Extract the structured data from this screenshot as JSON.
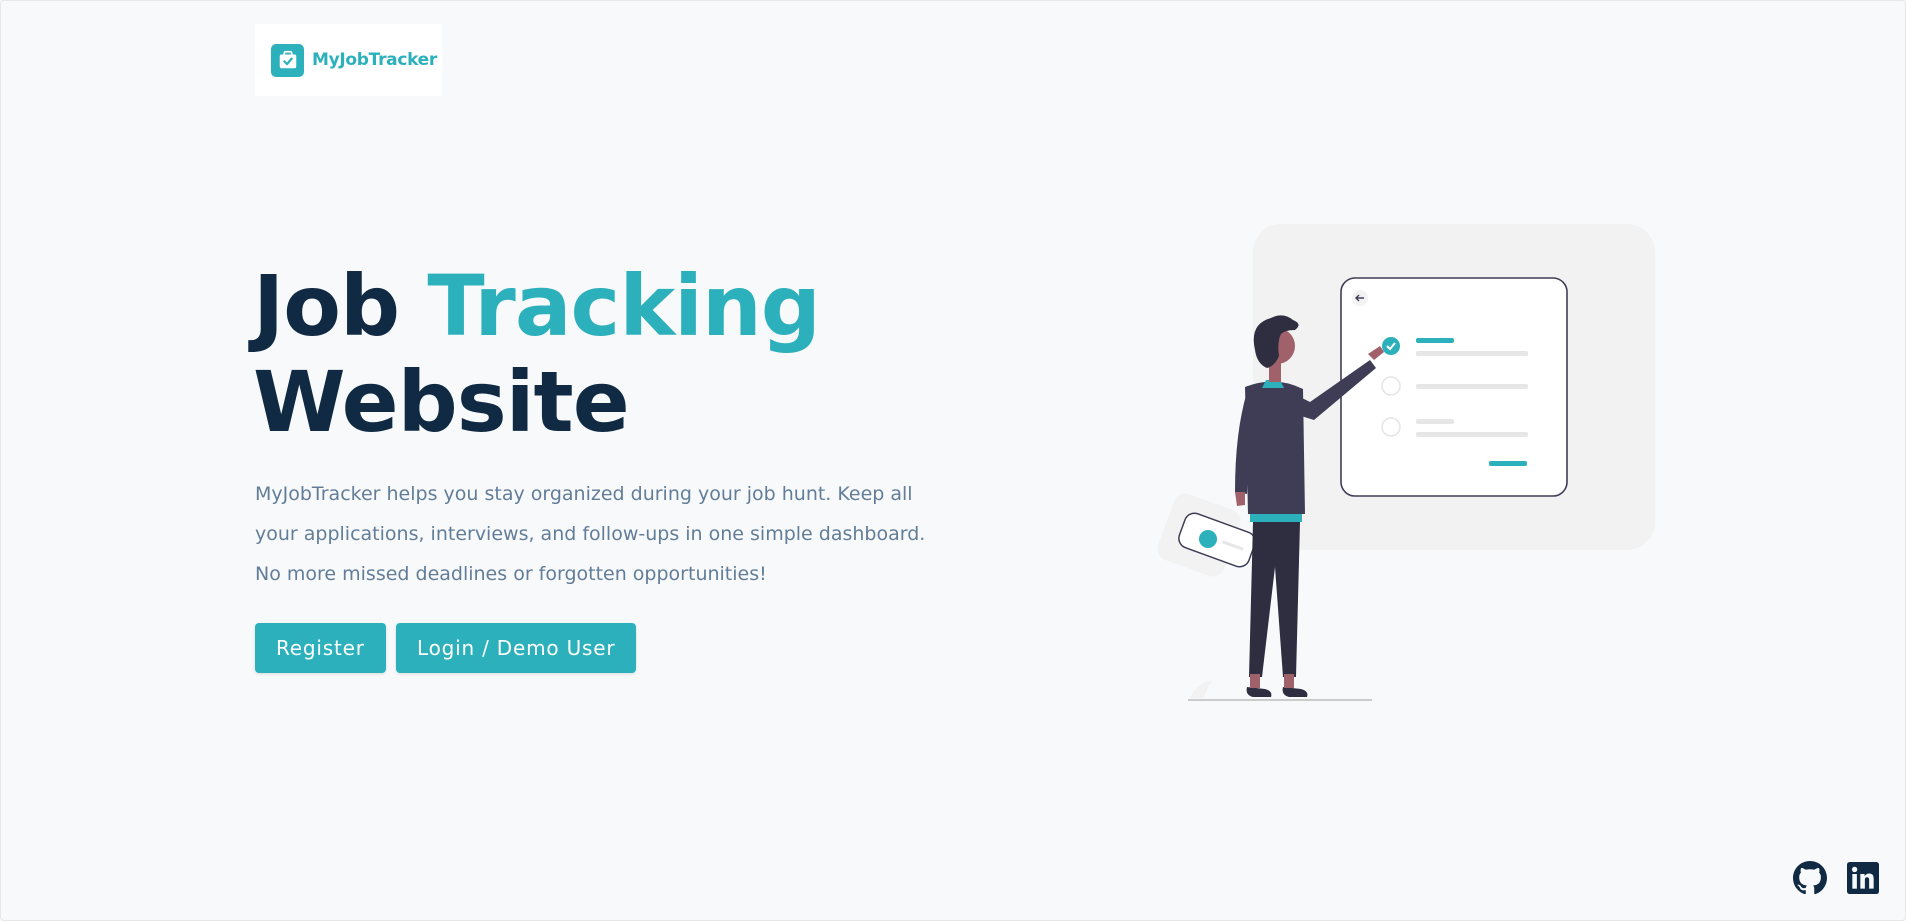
{
  "brand": {
    "name": "MyJobTracker",
    "logo_icon": "briefcase-check-icon",
    "color": "#2cb1bc"
  },
  "hero": {
    "title_word_1": "Job",
    "title_word_2": "Tracking",
    "title_line_2": "Website",
    "description": "MyJobTracker helps you stay organized during your job hunt. Keep all your applications, interviews, and follow-ups in one simple dashboard. No more missed deadlines or forgotten opportunities!",
    "register_label": "Register",
    "login_label": "Login / Demo User"
  },
  "illustration": {
    "name": "person-checking-task-list-illustration",
    "checklist_checked_items": 1,
    "checklist_total_items": 3
  },
  "social": {
    "github_icon": "github-icon",
    "linkedin_icon": "linkedin-icon"
  },
  "colors": {
    "primary": "#2cb1bc",
    "heading": "#102a43",
    "text": "#627d98",
    "background": "#f8f9fb"
  }
}
